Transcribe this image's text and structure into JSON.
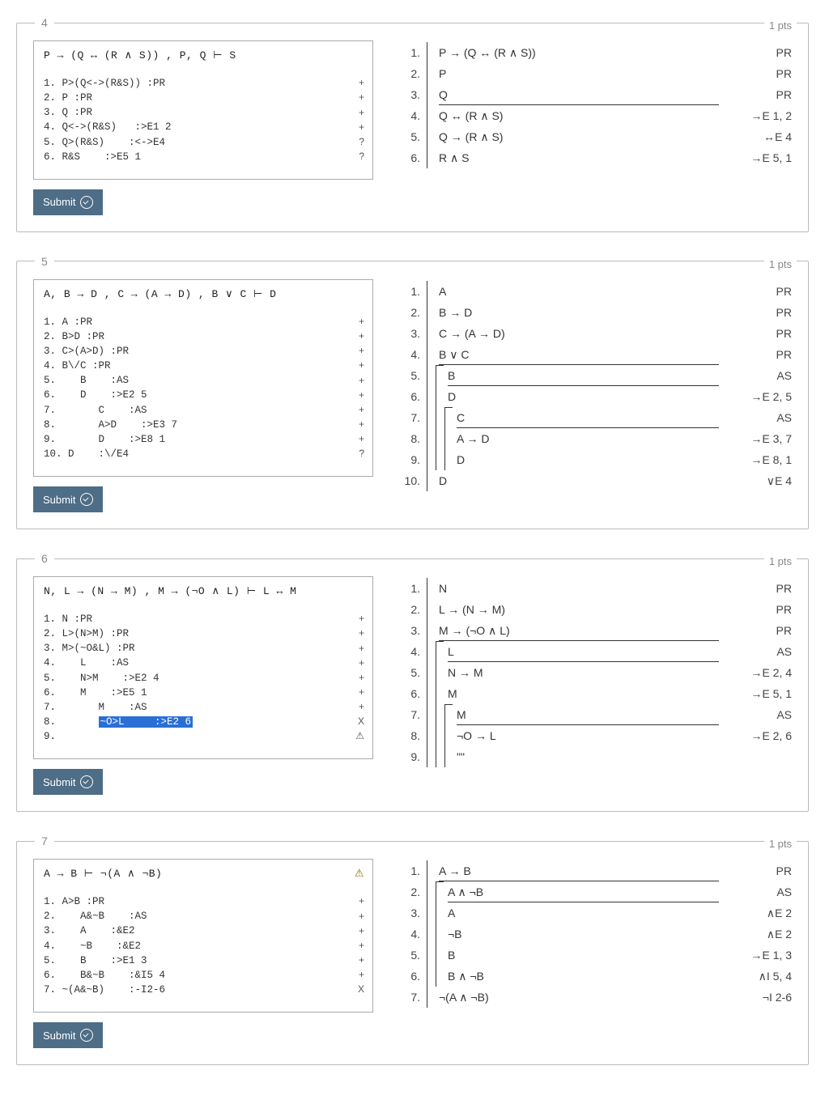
{
  "submit_label": "Submit",
  "pts_label": "1 pts",
  "questions": [
    {
      "num": "4",
      "sequent": "P → (Q ↔ (R ∧ S)) , P, Q ⊢ S",
      "seq_warn": "",
      "work_lines": [
        {
          "text": "1. P>(Q<->(R&S)) :PR",
          "mark": "+"
        },
        {
          "text": "2. P :PR",
          "mark": "+"
        },
        {
          "text": "3. Q :PR",
          "mark": "+"
        },
        {
          "text": "4. Q<->(R&S)   :>E1 2",
          "mark": "+"
        },
        {
          "text": "5. Q>(R&S)    :<->E4",
          "mark": "?"
        },
        {
          "text": "6. R&S    :>E5 1",
          "mark": "?"
        }
      ],
      "proof": [
        {
          "n": "1.",
          "d": 1,
          "closes": [],
          "f": "P → (Q ↔ (R ∧ S))",
          "j": "PR"
        },
        {
          "n": "2.",
          "d": 1,
          "closes": [],
          "f": "P",
          "j": "PR"
        },
        {
          "n": "3.",
          "d": 1,
          "closes": [],
          "f": "Q",
          "j": "PR",
          "underline": true
        },
        {
          "n": "4.",
          "d": 1,
          "closes": [],
          "f": "Q ↔ (R ∧ S)",
          "j": "→E 1, 2"
        },
        {
          "n": "5.",
          "d": 1,
          "closes": [],
          "f": "Q → (R ∧ S)",
          "j": "↔E 4"
        },
        {
          "n": "6.",
          "d": 1,
          "closes": [],
          "f": "R ∧ S",
          "j": "→E 5, 1"
        }
      ]
    },
    {
      "num": "5",
      "sequent": "A, B → D , C → (A → D) , B ∨ C ⊢ D",
      "seq_warn": "",
      "work_lines": [
        {
          "text": "1. A :PR",
          "mark": "+"
        },
        {
          "text": "2. B>D :PR",
          "mark": "+"
        },
        {
          "text": "3. C>(A>D) :PR",
          "mark": "+"
        },
        {
          "text": "4. B\\/C :PR",
          "mark": "+"
        },
        {
          "text": "5.    B    :AS",
          "mark": "+"
        },
        {
          "text": "6.    D    :>E2 5",
          "mark": "+"
        },
        {
          "text": "7.       C    :AS",
          "mark": "+"
        },
        {
          "text": "8.       A>D    :>E3 7",
          "mark": "+"
        },
        {
          "text": "9.       D    :>E8 1",
          "mark": "+"
        },
        {
          "text": "10. D    :\\/E4",
          "mark": "?"
        }
      ],
      "proof": [
        {
          "n": "1.",
          "d": 1,
          "closes": [],
          "f": "A",
          "j": "PR"
        },
        {
          "n": "2.",
          "d": 1,
          "closes": [],
          "f": "B → D",
          "j": "PR"
        },
        {
          "n": "3.",
          "d": 1,
          "closes": [],
          "f": "C → (A → D)",
          "j": "PR"
        },
        {
          "n": "4.",
          "d": 1,
          "closes": [],
          "f": "B ∨ C",
          "j": "PR",
          "underline": true
        },
        {
          "n": "5.",
          "d": 2,
          "closes": [
            2
          ],
          "f": "B",
          "j": "AS",
          "underline": true
        },
        {
          "n": "6.",
          "d": 2,
          "closes": [],
          "f": "D",
          "j": "→E 2, 5"
        },
        {
          "n": "7.",
          "d": 3,
          "closes": [
            3
          ],
          "f": "C",
          "j": "AS",
          "underline": true
        },
        {
          "n": "8.",
          "d": 3,
          "closes": [],
          "f": "A → D",
          "j": "→E 3, 7"
        },
        {
          "n": "9.",
          "d": 3,
          "closes": [],
          "f": "D",
          "j": "→E 8, 1"
        },
        {
          "n": "10.",
          "d": 1,
          "closes": [],
          "f": "D",
          "j": "∨E 4"
        }
      ]
    },
    {
      "num": "6",
      "sequent": "N, L → (N → M) , M → (¬O ∧ L) ⊢ L ↔ M",
      "seq_warn": "",
      "work_lines": [
        {
          "text": "1. N :PR",
          "mark": "+"
        },
        {
          "text": "2. L>(N>M) :PR",
          "mark": "+"
        },
        {
          "text": "3. M>(~O&L) :PR",
          "mark": "+"
        },
        {
          "text": "4.    L    :AS",
          "mark": "+"
        },
        {
          "text": "5.    N>M    :>E2 4",
          "mark": "+"
        },
        {
          "text": "6.    M    :>E5 1",
          "mark": "+"
        },
        {
          "text": "7.       M    :AS",
          "mark": "+"
        },
        {
          "text": "8.       ~O>L     :>E2 6",
          "mark": "X",
          "hl": true
        },
        {
          "text": "9.",
          "mark": "⚠"
        }
      ],
      "proof": [
        {
          "n": "1.",
          "d": 1,
          "closes": [],
          "f": "N",
          "j": "PR"
        },
        {
          "n": "2.",
          "d": 1,
          "closes": [],
          "f": "L → (N → M)",
          "j": "PR"
        },
        {
          "n": "3.",
          "d": 1,
          "closes": [],
          "f": "M → (¬O ∧ L)",
          "j": "PR",
          "underline": true
        },
        {
          "n": "4.",
          "d": 2,
          "closes": [
            2
          ],
          "f": "L",
          "j": "AS",
          "underline": true
        },
        {
          "n": "5.",
          "d": 2,
          "closes": [],
          "f": "N → M",
          "j": "→E 2, 4"
        },
        {
          "n": "6.",
          "d": 2,
          "closes": [],
          "f": "M",
          "j": "→E 5, 1"
        },
        {
          "n": "7.",
          "d": 3,
          "closes": [
            3
          ],
          "f": "M",
          "j": "AS",
          "underline": true
        },
        {
          "n": "8.",
          "d": 3,
          "closes": [],
          "f": "¬O → L",
          "j": "→E 2, 6"
        },
        {
          "n": "9.",
          "d": 3,
          "closes": [],
          "f": "\"\"",
          "j": ""
        }
      ]
    },
    {
      "num": "7",
      "sequent": "A → B ⊢ ¬(A ∧ ¬B)",
      "seq_warn": "⚠",
      "work_lines": [
        {
          "text": "1. A>B :PR",
          "mark": "+"
        },
        {
          "text": "2.    A&~B    :AS",
          "mark": "+"
        },
        {
          "text": "3.    A    :&E2",
          "mark": "+"
        },
        {
          "text": "4.    ~B    :&E2",
          "mark": "+"
        },
        {
          "text": "5.    B    :>E1 3",
          "mark": "+"
        },
        {
          "text": "6.    B&~B    :&I5 4",
          "mark": "+"
        },
        {
          "text": "7. ~(A&~B)    :-I2-6",
          "mark": "X"
        }
      ],
      "proof": [
        {
          "n": "1.",
          "d": 1,
          "closes": [],
          "f": "A → B",
          "j": "PR",
          "underline": true
        },
        {
          "n": "2.",
          "d": 2,
          "closes": [
            2
          ],
          "f": "A ∧ ¬B",
          "j": "AS",
          "underline": true
        },
        {
          "n": "3.",
          "d": 2,
          "closes": [],
          "f": "A",
          "j": "∧E 2"
        },
        {
          "n": "4.",
          "d": 2,
          "closes": [],
          "f": "¬B",
          "j": "∧E 2"
        },
        {
          "n": "5.",
          "d": 2,
          "closes": [],
          "f": "B",
          "j": "→E 1, 3"
        },
        {
          "n": "6.",
          "d": 2,
          "closes": [],
          "f": "B ∧ ¬B",
          "j": "∧I 5, 4"
        },
        {
          "n": "7.",
          "d": 1,
          "closes": [],
          "f": "¬(A ∧ ¬B)",
          "j": "¬I 2-6"
        }
      ]
    }
  ]
}
